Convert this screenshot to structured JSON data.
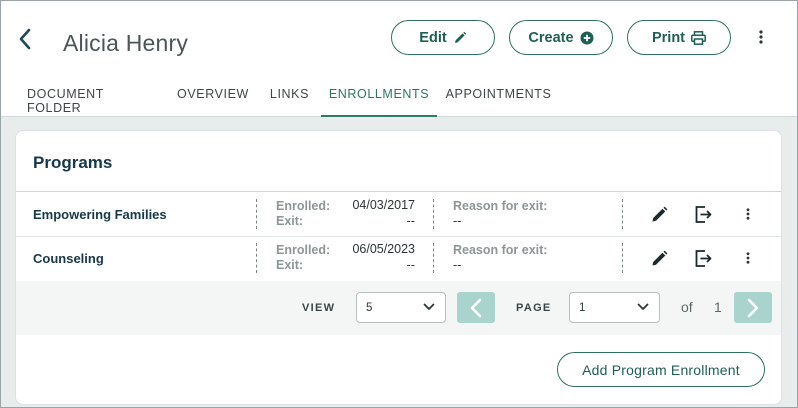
{
  "header": {
    "name": "Alicia Henry",
    "buttons": {
      "edit": "Edit",
      "create": "Create",
      "print": "Print"
    }
  },
  "tabs": [
    {
      "label": "DOCUMENT FOLDER",
      "active": false
    },
    {
      "label": "OVERVIEW",
      "active": false
    },
    {
      "label": "LINKS",
      "active": false
    },
    {
      "label": "ENROLLMENTS",
      "active": true
    },
    {
      "label": "APPOINTMENTS",
      "active": false
    }
  ],
  "programs": {
    "title": "Programs",
    "labels": {
      "enrolled": "Enrolled:",
      "exit": "Exit:",
      "reason": "Reason for exit:"
    },
    "rows": [
      {
        "name": "Empowering Families",
        "enrolled": "04/03/2017",
        "exit": "--",
        "reason": "--"
      },
      {
        "name": "Counseling",
        "enrolled": "06/05/2023",
        "exit": "--",
        "reason": "--"
      }
    ]
  },
  "pagination": {
    "view_label": "VIEW",
    "view_value": "5",
    "page_label": "PAGE",
    "page_value": "1",
    "of_label": "of",
    "total_pages": "1"
  },
  "add_button": "Add Program Enrollment",
  "colors": {
    "accent": "#2f7063",
    "pager_disabled": "#a9d3cd",
    "title": "#17384a"
  }
}
